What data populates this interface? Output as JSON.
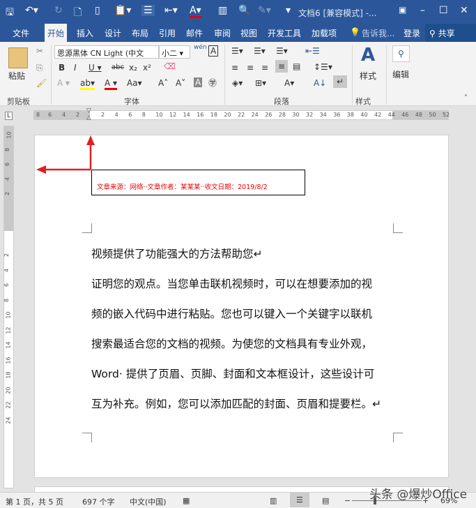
{
  "window": {
    "title": "文档6 [兼容模式] -..."
  },
  "quick_access": [
    "save-icon",
    "undo-icon",
    "redo-icon",
    "print-preview-icon",
    "new-icon",
    "paste-icon",
    "layout-icon",
    "align-icon",
    "font-color-icon",
    "columns-icon",
    "find-icon",
    "draw-icon",
    "customize-icon"
  ],
  "tabs": [
    {
      "label": "文件"
    },
    {
      "label": "开始"
    },
    {
      "label": "插入"
    },
    {
      "label": "设计"
    },
    {
      "label": "布局"
    },
    {
      "label": "引用"
    },
    {
      "label": "邮件"
    },
    {
      "label": "审阅"
    },
    {
      "label": "视图"
    },
    {
      "label": "开发工具"
    },
    {
      "label": "加载项"
    }
  ],
  "tell_me": "告诉我...",
  "login": "登录",
  "share": "共享",
  "ribbon": {
    "paste": "粘贴",
    "font_name": "思源黑体 CN Light (中文",
    "font_size": "小二",
    "wen": "wén",
    "styles": "样式",
    "edit": "编辑",
    "groups": {
      "clipboard": "剪贴板",
      "font": "字体",
      "paragraph": "段落",
      "styles": "样式"
    }
  },
  "ruler": {
    "left": [
      "8",
      "6",
      "4",
      "2"
    ],
    "right": [
      "2",
      "4",
      "6",
      "8",
      "10",
      "12",
      "14",
      "16",
      "18",
      "20",
      "22",
      "24",
      "26",
      "28",
      "30",
      "32",
      "34",
      "36",
      "38",
      "40",
      "42",
      "44",
      "46",
      "48",
      "50",
      "52"
    ],
    "vertical_top": [
      "10",
      "8",
      "6",
      "4",
      "2"
    ],
    "vertical": [
      "2",
      "4",
      "6",
      "8",
      "10",
      "12",
      "14",
      "16",
      "18",
      "20",
      "22",
      "24"
    ]
  },
  "document": {
    "source_line": "文章来源：网络··文章作者：某某某··收文日期：2019/8/2",
    "lines": [
      "视频提供了功能强大的方法帮助您↵",
      "证明您的观点。当您单击联机视频时，可以在想要添加的视",
      "频的嵌入代码中进行粘贴。您也可以键入一个关键字以联机",
      "搜索最适合您的文档的视频。为使您的文档具有专业外观，",
      "Word· 提供了页眉、页脚、封面和文本框设计，这些设计可",
      "互为补充。例如，您可以添加匹配的封面、页眉和提要栏。↵"
    ]
  },
  "status": {
    "page": "第 1 页，共 5 页",
    "words": "697 个字",
    "lang": "中文(中国)",
    "zoom": "69%",
    "zoom_percent": 69,
    "watermark": "头条 @爆炒Office"
  },
  "colors": {
    "accent": "#2b579a",
    "annotation": "#e02020"
  }
}
